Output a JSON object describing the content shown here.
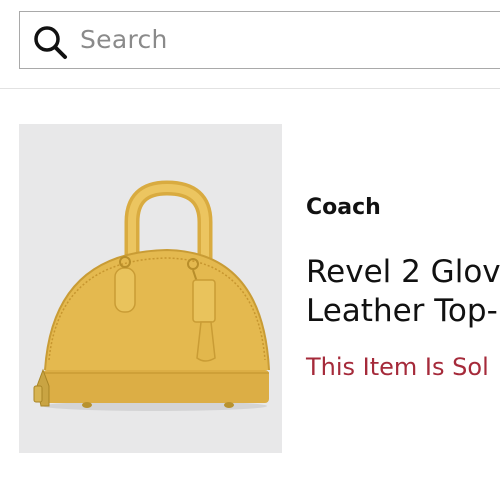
{
  "search": {
    "placeholder": "Search",
    "icon": "search-icon"
  },
  "product": {
    "brand": "Coach",
    "title_lines": [
      "Revel 2 Glov",
      "Leather Top-"
    ],
    "status": "This Item Is Sol",
    "image_icon": "handbag-image"
  },
  "colors": {
    "bag": "#e4b94f",
    "sold_out": "#a52a3a",
    "image_background": "#e8e8e9"
  }
}
